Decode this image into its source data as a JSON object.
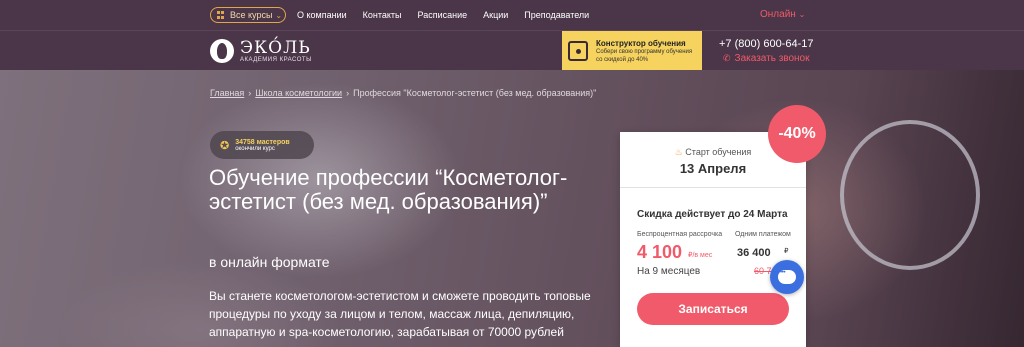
{
  "topbar": {
    "courses_label": "Все курсы",
    "nav": [
      "О компании",
      "Контакты",
      "Расписание",
      "Акции",
      "Преподаватели"
    ],
    "online_label": "Онлайн"
  },
  "header": {
    "logo_name": "ЭКО́ЛЬ",
    "logo_sub": "АКАДЕМИЯ КРАСОТЫ",
    "constructor_title": "Конструктор обучения",
    "constructor_desc": "Собери свою программу обучения со скидкой до 40%",
    "phone": "+7 (800) 600-64-17",
    "callback": "Заказать звонок"
  },
  "breadcrumb": {
    "home": "Главная",
    "section": "Школа косметологии",
    "current": "Профессия \"Косметолог-эстетист (без мед. образования)\""
  },
  "hero": {
    "masters_count": "34758 мастеров",
    "masters_sub": "окончили курс",
    "title": "Обучение профессии “Косметолог-эстетист (без мед. образования)”",
    "subtitle": "в онлайн формате",
    "description": "Вы станете косметологом-эстетистом и сможете проводить топовые процедуры по уходу за лицом и телом, массаж лица, депиляцию, аппаратную и spa-косметологию, зарабатывая от 70000 рублей"
  },
  "card": {
    "start_label": "Старт обучения",
    "start_date": "13 Апреля",
    "discount_note": "Скидка действует до 24 Марта",
    "installment_label": "Беспроцентная рассрочка",
    "single_label": "Одним платежом",
    "installment_price": "4 100",
    "installment_unit": "₽/в мес",
    "single_price": "36 400",
    "currency": "₽",
    "months": "На 9 месяцев",
    "old_price": "60 7",
    "enroll_label": "Записаться",
    "discount_badge": "-40%"
  },
  "colors": {
    "accent": "#f05a6a",
    "header_bg": "#4a3648",
    "constructor_bg": "#f6d25e",
    "chat": "#3b6fe0"
  },
  "icons": [
    "grid-icon",
    "chevron-down-icon",
    "puzzle-icon",
    "phone-icon",
    "stars-icon",
    "flame-icon",
    "chat-icon"
  ]
}
